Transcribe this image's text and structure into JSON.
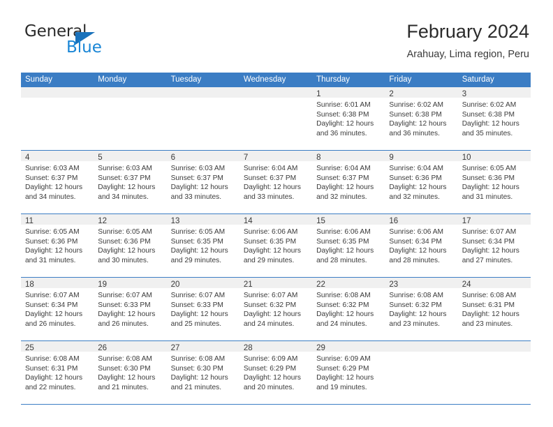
{
  "brand": {
    "name_part1": "General",
    "name_part2": "Blue",
    "triangle_color": "#1a72bb",
    "blue_color": "#1a86d6"
  },
  "header": {
    "title": "February 2024",
    "subtitle": "Arahuay, Lima region, Peru"
  },
  "theme": {
    "header_bar_color": "#3b7dc4",
    "day_band_color": "#f0f0f0",
    "rule_color": "#3b7dc4",
    "text_color": "#3a3a3a"
  },
  "weekdays": [
    "Sunday",
    "Monday",
    "Tuesday",
    "Wednesday",
    "Thursday",
    "Friday",
    "Saturday"
  ],
  "weeks": [
    [
      {
        "day": "",
        "sunrise": "",
        "sunset": "",
        "daylight_line1": "",
        "daylight_line2": ""
      },
      {
        "day": "",
        "sunrise": "",
        "sunset": "",
        "daylight_line1": "",
        "daylight_line2": ""
      },
      {
        "day": "",
        "sunrise": "",
        "sunset": "",
        "daylight_line1": "",
        "daylight_line2": ""
      },
      {
        "day": "",
        "sunrise": "",
        "sunset": "",
        "daylight_line1": "",
        "daylight_line2": ""
      },
      {
        "day": "1",
        "sunrise": "Sunrise: 6:01 AM",
        "sunset": "Sunset: 6:38 PM",
        "daylight_line1": "Daylight: 12 hours",
        "daylight_line2": "and 36 minutes."
      },
      {
        "day": "2",
        "sunrise": "Sunrise: 6:02 AM",
        "sunset": "Sunset: 6:38 PM",
        "daylight_line1": "Daylight: 12 hours",
        "daylight_line2": "and 36 minutes."
      },
      {
        "day": "3",
        "sunrise": "Sunrise: 6:02 AM",
        "sunset": "Sunset: 6:38 PM",
        "daylight_line1": "Daylight: 12 hours",
        "daylight_line2": "and 35 minutes."
      }
    ],
    [
      {
        "day": "4",
        "sunrise": "Sunrise: 6:03 AM",
        "sunset": "Sunset: 6:37 PM",
        "daylight_line1": "Daylight: 12 hours",
        "daylight_line2": "and 34 minutes."
      },
      {
        "day": "5",
        "sunrise": "Sunrise: 6:03 AM",
        "sunset": "Sunset: 6:37 PM",
        "daylight_line1": "Daylight: 12 hours",
        "daylight_line2": "and 34 minutes."
      },
      {
        "day": "6",
        "sunrise": "Sunrise: 6:03 AM",
        "sunset": "Sunset: 6:37 PM",
        "daylight_line1": "Daylight: 12 hours",
        "daylight_line2": "and 33 minutes."
      },
      {
        "day": "7",
        "sunrise": "Sunrise: 6:04 AM",
        "sunset": "Sunset: 6:37 PM",
        "daylight_line1": "Daylight: 12 hours",
        "daylight_line2": "and 33 minutes."
      },
      {
        "day": "8",
        "sunrise": "Sunrise: 6:04 AM",
        "sunset": "Sunset: 6:37 PM",
        "daylight_line1": "Daylight: 12 hours",
        "daylight_line2": "and 32 minutes."
      },
      {
        "day": "9",
        "sunrise": "Sunrise: 6:04 AM",
        "sunset": "Sunset: 6:36 PM",
        "daylight_line1": "Daylight: 12 hours",
        "daylight_line2": "and 32 minutes."
      },
      {
        "day": "10",
        "sunrise": "Sunrise: 6:05 AM",
        "sunset": "Sunset: 6:36 PM",
        "daylight_line1": "Daylight: 12 hours",
        "daylight_line2": "and 31 minutes."
      }
    ],
    [
      {
        "day": "11",
        "sunrise": "Sunrise: 6:05 AM",
        "sunset": "Sunset: 6:36 PM",
        "daylight_line1": "Daylight: 12 hours",
        "daylight_line2": "and 31 minutes."
      },
      {
        "day": "12",
        "sunrise": "Sunrise: 6:05 AM",
        "sunset": "Sunset: 6:36 PM",
        "daylight_line1": "Daylight: 12 hours",
        "daylight_line2": "and 30 minutes."
      },
      {
        "day": "13",
        "sunrise": "Sunrise: 6:05 AM",
        "sunset": "Sunset: 6:35 PM",
        "daylight_line1": "Daylight: 12 hours",
        "daylight_line2": "and 29 minutes."
      },
      {
        "day": "14",
        "sunrise": "Sunrise: 6:06 AM",
        "sunset": "Sunset: 6:35 PM",
        "daylight_line1": "Daylight: 12 hours",
        "daylight_line2": "and 29 minutes."
      },
      {
        "day": "15",
        "sunrise": "Sunrise: 6:06 AM",
        "sunset": "Sunset: 6:35 PM",
        "daylight_line1": "Daylight: 12 hours",
        "daylight_line2": "and 28 minutes."
      },
      {
        "day": "16",
        "sunrise": "Sunrise: 6:06 AM",
        "sunset": "Sunset: 6:34 PM",
        "daylight_line1": "Daylight: 12 hours",
        "daylight_line2": "and 28 minutes."
      },
      {
        "day": "17",
        "sunrise": "Sunrise: 6:07 AM",
        "sunset": "Sunset: 6:34 PM",
        "daylight_line1": "Daylight: 12 hours",
        "daylight_line2": "and 27 minutes."
      }
    ],
    [
      {
        "day": "18",
        "sunrise": "Sunrise: 6:07 AM",
        "sunset": "Sunset: 6:34 PM",
        "daylight_line1": "Daylight: 12 hours",
        "daylight_line2": "and 26 minutes."
      },
      {
        "day": "19",
        "sunrise": "Sunrise: 6:07 AM",
        "sunset": "Sunset: 6:33 PM",
        "daylight_line1": "Daylight: 12 hours",
        "daylight_line2": "and 26 minutes."
      },
      {
        "day": "20",
        "sunrise": "Sunrise: 6:07 AM",
        "sunset": "Sunset: 6:33 PM",
        "daylight_line1": "Daylight: 12 hours",
        "daylight_line2": "and 25 minutes."
      },
      {
        "day": "21",
        "sunrise": "Sunrise: 6:07 AM",
        "sunset": "Sunset: 6:32 PM",
        "daylight_line1": "Daylight: 12 hours",
        "daylight_line2": "and 24 minutes."
      },
      {
        "day": "22",
        "sunrise": "Sunrise: 6:08 AM",
        "sunset": "Sunset: 6:32 PM",
        "daylight_line1": "Daylight: 12 hours",
        "daylight_line2": "and 24 minutes."
      },
      {
        "day": "23",
        "sunrise": "Sunrise: 6:08 AM",
        "sunset": "Sunset: 6:32 PM",
        "daylight_line1": "Daylight: 12 hours",
        "daylight_line2": "and 23 minutes."
      },
      {
        "day": "24",
        "sunrise": "Sunrise: 6:08 AM",
        "sunset": "Sunset: 6:31 PM",
        "daylight_line1": "Daylight: 12 hours",
        "daylight_line2": "and 23 minutes."
      }
    ],
    [
      {
        "day": "25",
        "sunrise": "Sunrise: 6:08 AM",
        "sunset": "Sunset: 6:31 PM",
        "daylight_line1": "Daylight: 12 hours",
        "daylight_line2": "and 22 minutes."
      },
      {
        "day": "26",
        "sunrise": "Sunrise: 6:08 AM",
        "sunset": "Sunset: 6:30 PM",
        "daylight_line1": "Daylight: 12 hours",
        "daylight_line2": "and 21 minutes."
      },
      {
        "day": "27",
        "sunrise": "Sunrise: 6:08 AM",
        "sunset": "Sunset: 6:30 PM",
        "daylight_line1": "Daylight: 12 hours",
        "daylight_line2": "and 21 minutes."
      },
      {
        "day": "28",
        "sunrise": "Sunrise: 6:09 AM",
        "sunset": "Sunset: 6:29 PM",
        "daylight_line1": "Daylight: 12 hours",
        "daylight_line2": "and 20 minutes."
      },
      {
        "day": "29",
        "sunrise": "Sunrise: 6:09 AM",
        "sunset": "Sunset: 6:29 PM",
        "daylight_line1": "Daylight: 12 hours",
        "daylight_line2": "and 19 minutes."
      },
      {
        "day": "",
        "sunrise": "",
        "sunset": "",
        "daylight_line1": "",
        "daylight_line2": ""
      },
      {
        "day": "",
        "sunrise": "",
        "sunset": "",
        "daylight_line1": "",
        "daylight_line2": ""
      }
    ]
  ]
}
